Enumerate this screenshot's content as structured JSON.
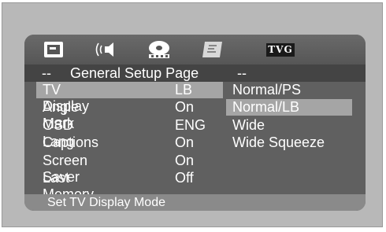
{
  "header": {
    "icons": [
      "tv-icon",
      "speaker-icon",
      "disc-reel-icon",
      "settings-panel-icon"
    ],
    "badge": "TVG"
  },
  "title": {
    "prefix": "--",
    "text": "General Setup Page",
    "suffix": "--"
  },
  "settings": [
    {
      "label": "TV Display",
      "value": "LB"
    },
    {
      "label": "Angle Mark",
      "value": "On"
    },
    {
      "label": "OSD Lang",
      "value": "ENG"
    },
    {
      "label": "Captions",
      "value": "On"
    },
    {
      "label": "Screen Saver",
      "value": "On"
    },
    {
      "label": "Last Memory",
      "value": "Off"
    }
  ],
  "options": [
    "Normal/PS",
    "Normal/LB",
    "Wide",
    "Wide Squeeze"
  ],
  "selected_option": "Normal/LB",
  "selected_setting": "TV Display",
  "status": "Set TV Display Mode",
  "colors": {
    "screen_bg": "#606060",
    "highlight": "#a5a5a5",
    "text": "#ffffff"
  }
}
